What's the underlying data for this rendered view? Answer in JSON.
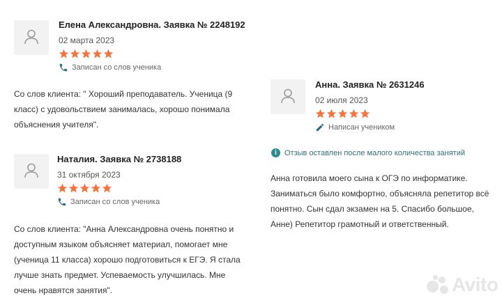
{
  "reviews": [
    {
      "author": "Елена Александровна. Заявка № 2248192",
      "date": "02 марта 2023",
      "rating": 5,
      "source": "Записан со слов ученика",
      "source_icon": "phone-icon",
      "text": "Со слов клиента: \" Хороший преподаватель. Ученица (9 класс) с удовольствием занималась, хорошо понимала объяснения учителя\"."
    },
    {
      "author": "Наталия. Заявка № 2738188",
      "date": "31 октября 2023",
      "rating": 5,
      "source": "Записан со слов ученика",
      "source_icon": "phone-icon",
      "text": "Со слов клиента: \"Анна Александровна очень понятно и доступным языком объясняет материал, помогает мне (ученица 11 класса) хорошо подготовиться к ЕГЭ. Я стала лучше знать предмет. Успеваемость улучшилась. Мне очень нравятся занятия\"."
    },
    {
      "author": "Анна. Заявка № 2631246",
      "date": "02 июля 2023",
      "rating": 5,
      "source": "Написан учеником",
      "source_icon": "pencil-icon",
      "notice": "Отзыв оставлен после малого количества занятий",
      "text": "Анна готовила моего сына к ОГЭ по информатике. Заниматься было комфортно, объясняла репетитор всё понятно. Сын сдал экзамен на 5. Спасибо большое, Анне) Репетитор грамотный и ответственный."
    }
  ],
  "watermark": "Avito",
  "colors": {
    "star": "#f4743b",
    "icon": "#2f6f7a",
    "notice": "#2f8a94"
  }
}
